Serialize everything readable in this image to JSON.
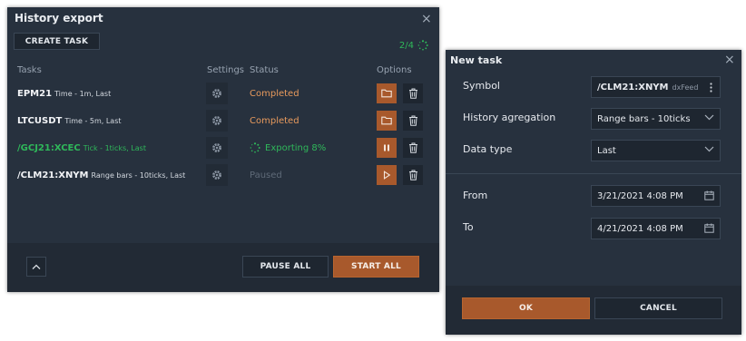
{
  "history": {
    "title": "History export",
    "create_task_label": "CREATE TASK",
    "counter": "2/4",
    "columns": {
      "tasks": "Tasks",
      "settings": "Settings",
      "status": "Status",
      "options": "Options"
    },
    "tasks": [
      {
        "name": "EPM21",
        "desc": "Time - 1m, Last",
        "status": "Completed",
        "state": "completed"
      },
      {
        "name": "LTCUSDT",
        "desc": "Time - 5m, Last",
        "status": "Completed",
        "state": "completed"
      },
      {
        "name": "/GCJ21:XCEC",
        "desc": "Tick - 1ticks, Last",
        "status": "Exporting 8%",
        "state": "exporting"
      },
      {
        "name": "/CLM21:XNYM",
        "desc": "Range bars - 10ticks, Last",
        "status": "Paused",
        "state": "paused"
      }
    ],
    "pause_all_label": "PAUSE ALL",
    "start_all_label": "START ALL"
  },
  "new_task": {
    "title": "New task",
    "symbol_label": "Symbol",
    "symbol_value": "/CLM21:XNYM",
    "symbol_source": "dxFeed",
    "aggregation_label": "History agregation",
    "aggregation_value": "Range bars - 10ticks",
    "data_type_label": "Data type",
    "data_type_value": "Last",
    "from_label": "From",
    "from_value": "3/21/2021 4:08 PM",
    "to_label": "To",
    "to_value": "4/21/2021 4:08 PM",
    "ok_label": "OK",
    "cancel_label": "CANCEL"
  },
  "colors": {
    "panel_bg": "#27313e",
    "accent_orange": "#a8592c",
    "completed": "#e89a5d",
    "exporting": "#2fb85a",
    "paused": "#6b7684"
  }
}
